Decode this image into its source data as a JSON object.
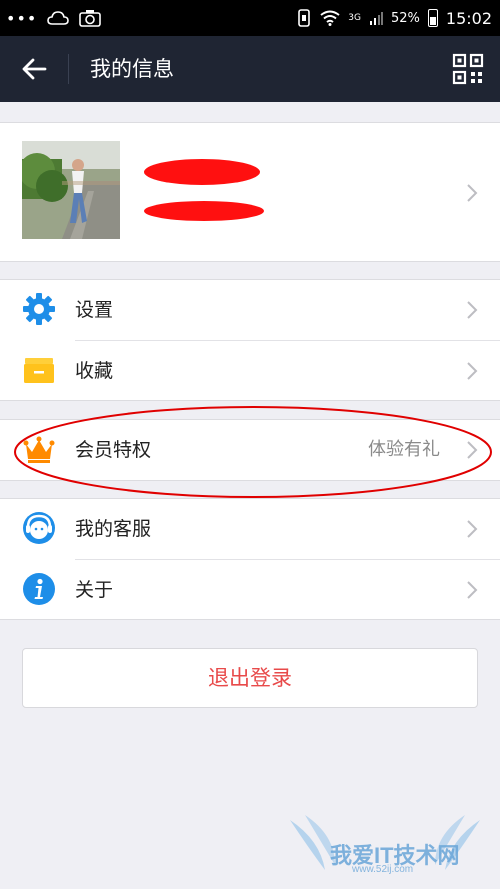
{
  "status_bar": {
    "battery_percent": "52%",
    "time": "15:02",
    "network": "3G"
  },
  "nav": {
    "title": "我的信息",
    "back_icon": "back-arrow-icon",
    "qr_icon": "qr-code-icon"
  },
  "menu": {
    "settings": {
      "label": "设置",
      "icon": "gear-icon"
    },
    "favorites": {
      "label": "收藏",
      "icon": "folder-icon"
    },
    "vip": {
      "label": "会员特权",
      "extra": "体验有礼",
      "icon": "crown-icon"
    },
    "service": {
      "label": "我的客服",
      "icon": "headset-icon"
    },
    "about": {
      "label": "关于",
      "icon": "info-icon"
    }
  },
  "logout_label": "退出登录",
  "watermark": {
    "text": "我爱IT技术网",
    "sub": "www.52ij.com"
  },
  "colors": {
    "navbar": "#1f2533",
    "accent_blue": "#1e8ee8",
    "folder_yellow": "#ffc21c",
    "crown_orange": "#ff8a00",
    "logout_red": "#e84a4a",
    "annotation_red": "#e00000"
  }
}
